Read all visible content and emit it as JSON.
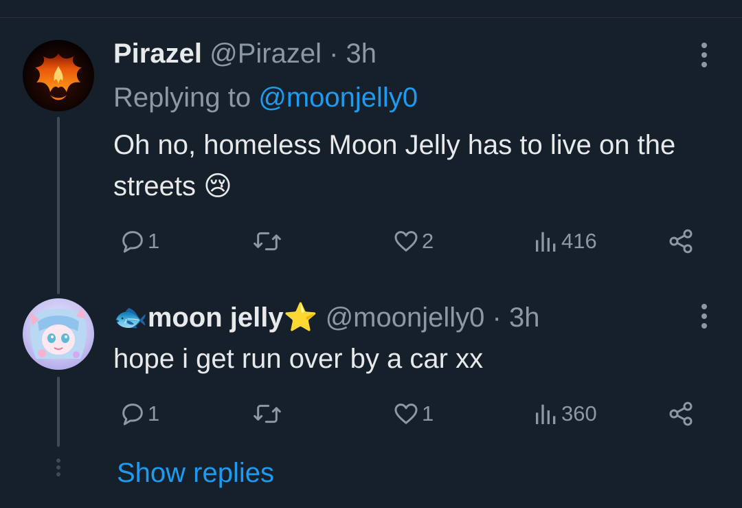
{
  "tweets": [
    {
      "display_name": "Pirazel",
      "handle": "@Pirazel",
      "time": "· 3h",
      "replying_prefix": "Replying to",
      "replying_to": "@moonjelly0",
      "text": "Oh no, homeless Moon Jelly has to live on the streets",
      "emoji": "😢",
      "reply_count": "1",
      "retweet_count": "",
      "like_count": "2",
      "view_count": "416"
    },
    {
      "display_name_prefix_emoji": "🐟",
      "display_name": "moon jelly",
      "display_name_suffix_emoji": "⭐",
      "handle": "@moonjelly0",
      "time": "· 3h",
      "text": "hope i get run over by a car xx",
      "reply_count": "1",
      "retweet_count": "",
      "like_count": "1",
      "view_count": "360"
    }
  ],
  "show_replies_label": "Show replies",
  "icons": {
    "reply": "reply-icon",
    "retweet": "retweet-icon",
    "like": "heart-icon",
    "views": "views-icon",
    "share": "share-icon",
    "more": "more-vertical-icon"
  },
  "colors": {
    "background": "#15202b",
    "accent": "#1d9bf0",
    "muted": "#8b98a5",
    "text": "#e7e9ea"
  }
}
